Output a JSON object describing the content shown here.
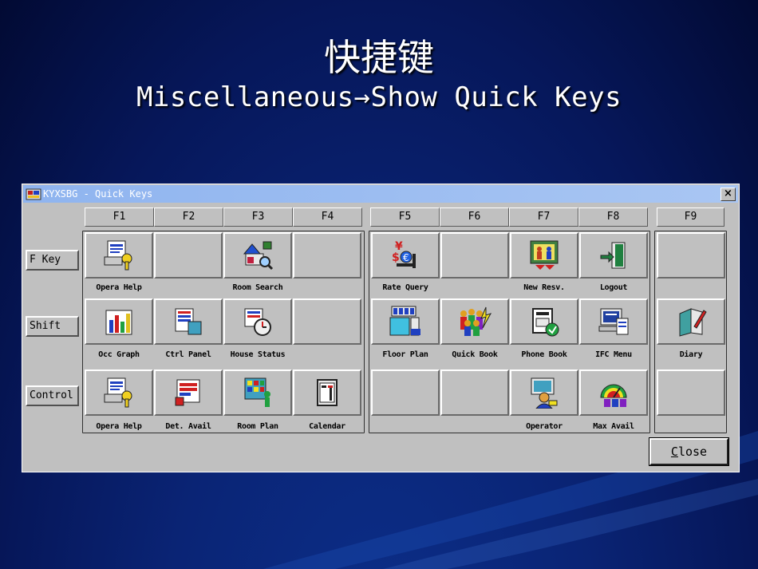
{
  "slide": {
    "title_cn": "快捷键",
    "title_en": "Miscellaneous→Show Quick Keys"
  },
  "window": {
    "title": "KYXSBG - Quick Keys",
    "close_glyph": "×",
    "close_button": {
      "mnemonic": "C",
      "rest": "lose"
    }
  },
  "fkeys": [
    "F1",
    "F2",
    "F3",
    "F4",
    "F5",
    "F6",
    "F7",
    "F8",
    "F9"
  ],
  "row_buttons": [
    "F Key",
    "Shift",
    "Control"
  ],
  "rows": [
    [
      {
        "label": "Opera Help",
        "icon": "help-key-icon"
      },
      {
        "label": "",
        "icon": ""
      },
      {
        "label": "Room Search",
        "icon": "room-search-icon"
      },
      {
        "label": "",
        "icon": ""
      },
      {
        "label": "Rate Query",
        "icon": "rate-query-icon"
      },
      {
        "label": "",
        "icon": ""
      },
      {
        "label": "New Resv.",
        "icon": "new-reservation-icon"
      },
      {
        "label": "Logout",
        "icon": "logout-door-icon"
      },
      {
        "label": "",
        "icon": ""
      }
    ],
    [
      {
        "label": "Occ Graph",
        "icon": "bar-graph-icon"
      },
      {
        "label": "Ctrl Panel",
        "icon": "control-panel-icon"
      },
      {
        "label": "House Status",
        "icon": "house-status-clock-icon"
      },
      {
        "label": "",
        "icon": ""
      },
      {
        "label": "Floor Plan",
        "icon": "floor-plan-icon"
      },
      {
        "label": "Quick Book",
        "icon": "group-people-icon"
      },
      {
        "label": "Phone Book",
        "icon": "phone-book-icon"
      },
      {
        "label": "IFC Menu",
        "icon": "ifc-computer-icon"
      },
      {
        "label": "Diary",
        "icon": "diary-pen-icon"
      }
    ],
    [
      {
        "label": "Opera Help",
        "icon": "help-key-icon"
      },
      {
        "label": "Det. Avail",
        "icon": "detail-avail-icon"
      },
      {
        "label": "Room Plan",
        "icon": "room-plan-icon"
      },
      {
        "label": "Calendar",
        "icon": "calendar-icon"
      },
      {
        "label": "",
        "icon": ""
      },
      {
        "label": "",
        "icon": ""
      },
      {
        "label": "Operator",
        "icon": "operator-icon"
      },
      {
        "label": "Max Avail",
        "icon": "max-avail-gauge-icon"
      },
      {
        "label": "",
        "icon": ""
      }
    ]
  ]
}
